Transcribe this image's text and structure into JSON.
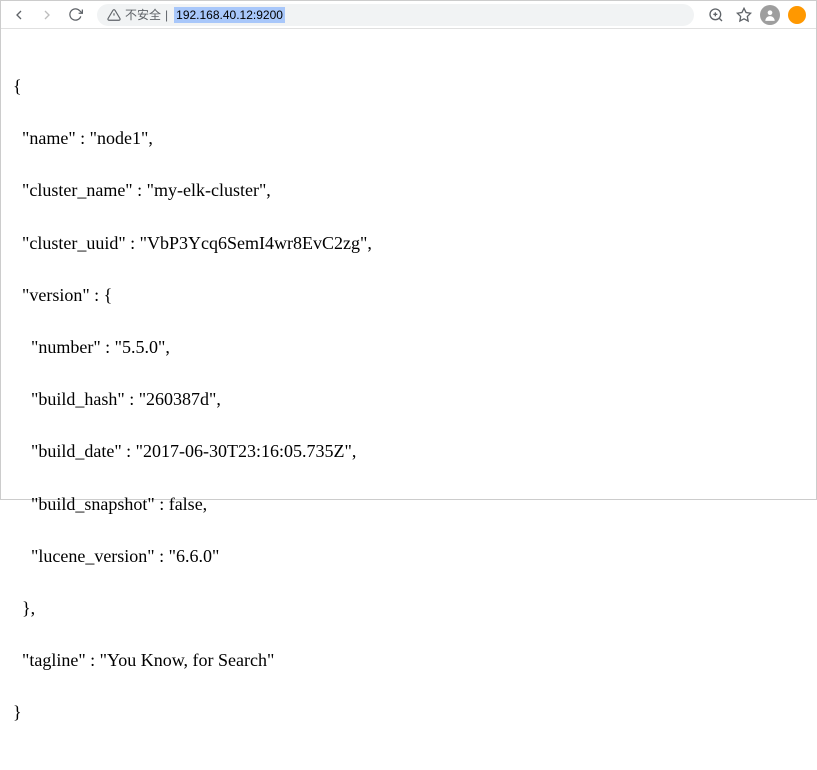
{
  "toolbar": {
    "security_label": "不安全",
    "url": "192.168.40.12:9200"
  },
  "json": {
    "open_brace": "{",
    "name_line": "  \"name\" : \"node1\",",
    "cluster_name_line": "  \"cluster_name\" : \"my-elk-cluster\",",
    "cluster_uuid_line": "  \"cluster_uuid\" : \"VbP3Ycq6SemI4wr8EvC2zg\",",
    "version_open": "  \"version\" : {",
    "number_line": "    \"number\" : \"5.5.0\",",
    "build_hash_line": "    \"build_hash\" : \"260387d\",",
    "build_date_line": "    \"build_date\" : \"2017-06-30T23:16:05.735Z\",",
    "build_snapshot_line": "    \"build_snapshot\" : false,",
    "lucene_version_line": "    \"lucene_version\" : \"6.6.0\"",
    "version_close": "  },",
    "tagline_line": "  \"tagline\" : \"You Know, for Search\"",
    "close_brace": "}"
  }
}
